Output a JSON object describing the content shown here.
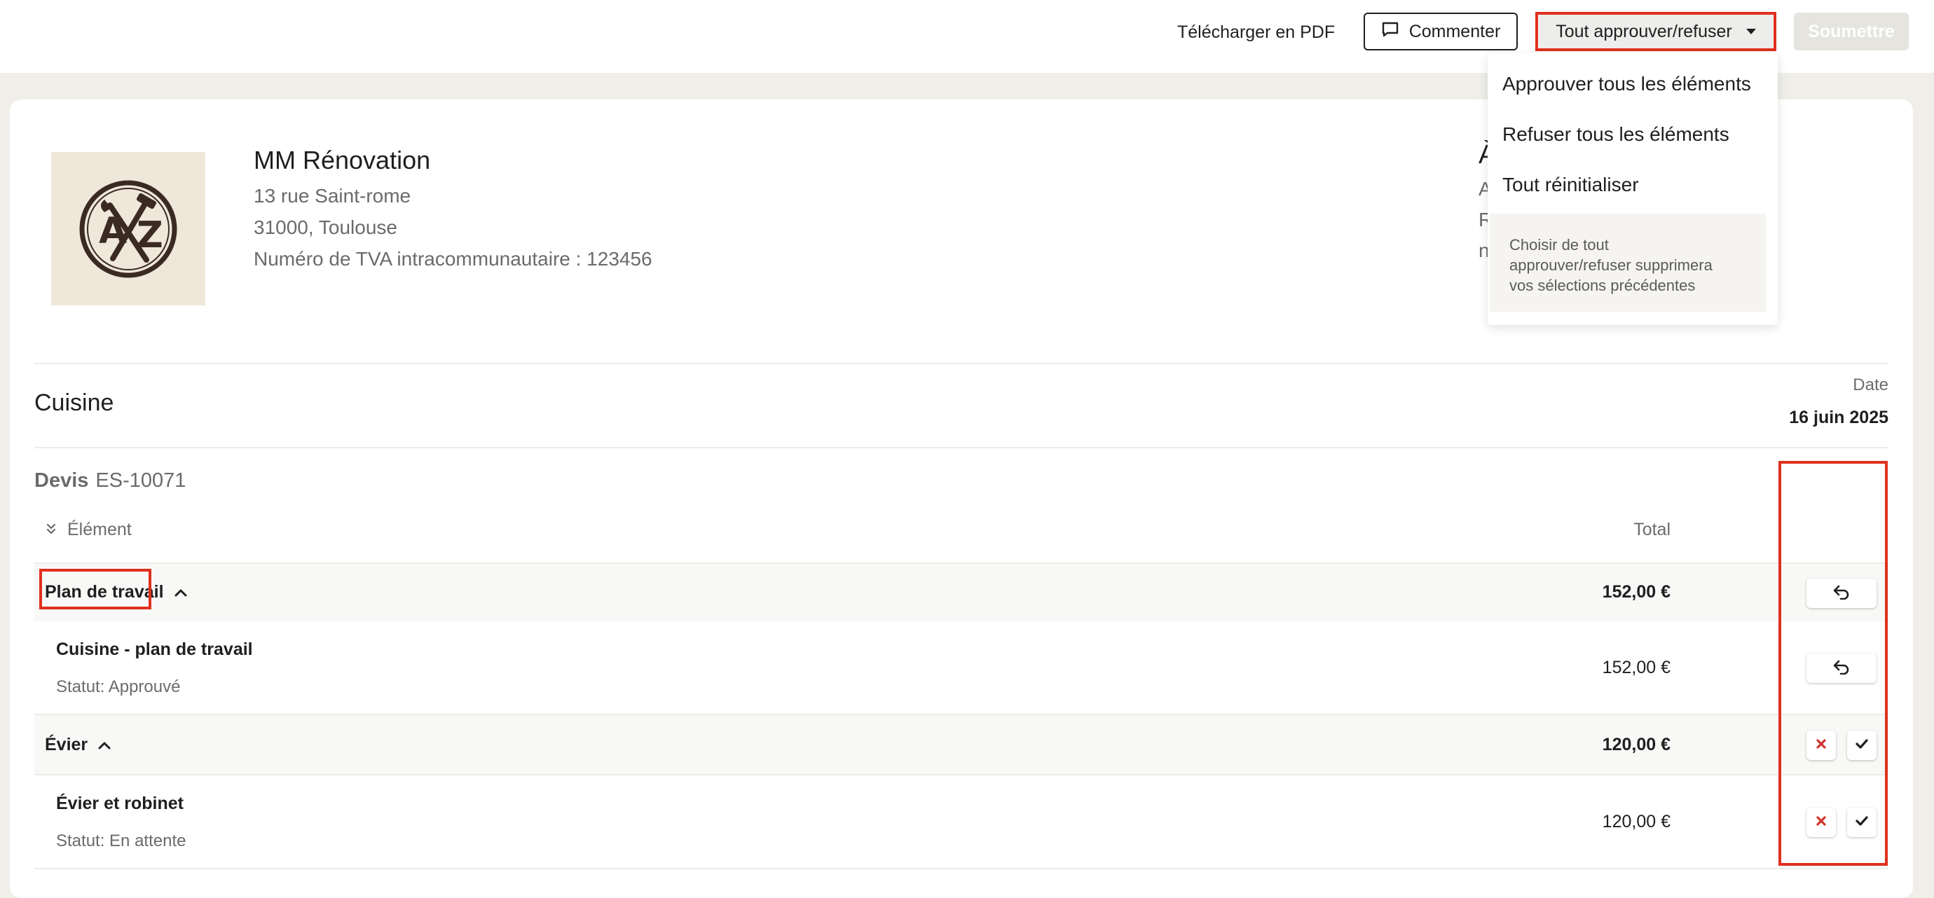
{
  "topbar": {
    "download_pdf": "Télécharger en PDF",
    "comment_label": "Commenter",
    "approve_all_label": "Tout approuver/refuser",
    "submit_label": "Soumettre"
  },
  "company": {
    "logo_text": "AZ",
    "name": "MM Rénovation",
    "address_line1": "13 rue Saint-rome",
    "address_line2": "31000, Toulouse",
    "vat": "Numéro de TVA intracommunautaire : 123456"
  },
  "recipient_partial": {
    "heading": "À",
    "line1": "A",
    "line2": "R",
    "line3": "n"
  },
  "section": {
    "title": "Cuisine",
    "date_label": "Date",
    "date_value": "16 juin 2025"
  },
  "quote": {
    "label": "Devis",
    "number": "ES-10071",
    "col_element": "Élément",
    "col_total": "Total"
  },
  "rows": [
    {
      "type": "group",
      "title": "Plan de travail",
      "amount": "152,00 €"
    },
    {
      "type": "item",
      "title": "Cuisine - plan de travail",
      "status": "Statut: Approuvé",
      "amount": "152,00 €"
    },
    {
      "type": "group",
      "title": "Évier",
      "amount": "120,00 €"
    },
    {
      "type": "item",
      "title": "Évier et robinet",
      "status": "Statut: En attente",
      "amount": "120,00 €"
    }
  ],
  "dropdown": {
    "approve_all": "Approuver tous les éléments",
    "reject_all": "Refuser tous les éléments",
    "reset_all": "Tout réinitialiser",
    "note_line1": "Choisir de tout",
    "note_line2": "approuver/refuser supprimera",
    "note_line3": "vos sélections précédentes"
  },
  "colors": {
    "highlight": "#e0301e",
    "reject": "#d0342c",
    "logo_bg": "#efe7da",
    "logo_ink": "#3a2a22"
  },
  "icons": [
    "comment-icon",
    "caret-down-icon",
    "expand-all-icon",
    "chevron-up-icon",
    "undo-icon",
    "reject-x-icon",
    "approve-check-icon"
  ]
}
